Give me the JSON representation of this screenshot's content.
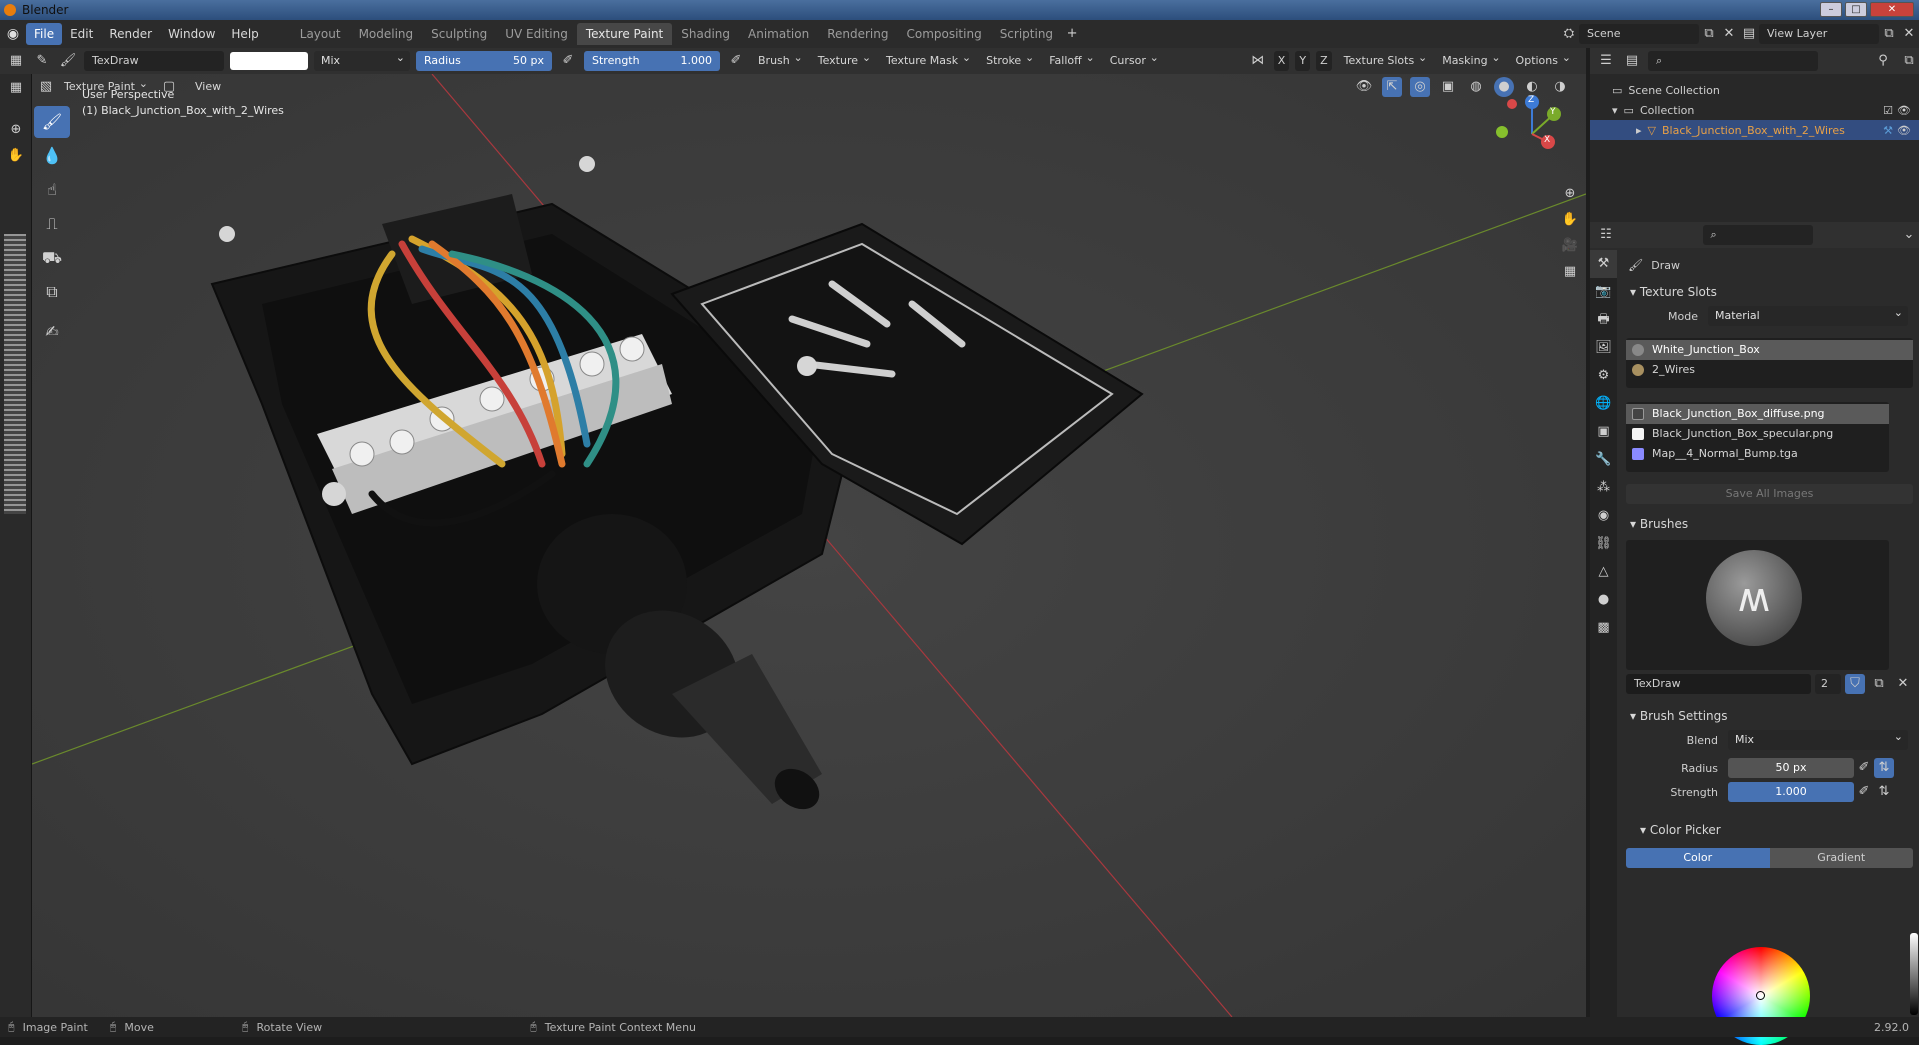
{
  "window": {
    "title": "Blender"
  },
  "menubar": {
    "menus": [
      "File",
      "Edit",
      "Render",
      "Window",
      "Help"
    ],
    "workspaces": [
      "Layout",
      "Modeling",
      "Sculpting",
      "UV Editing",
      "Texture Paint",
      "Shading",
      "Animation",
      "Rendering",
      "Compositing",
      "Scripting"
    ],
    "active_workspace": "Texture Paint",
    "scene": "Scene",
    "view_layer": "View Layer"
  },
  "header": {
    "brush_name": "TexDraw",
    "blend": "Mix",
    "radius_label": "Radius",
    "radius_value": "50 px",
    "strength_label": "Strength",
    "strength_value": "1.000",
    "menus": [
      "Brush",
      "Texture",
      "Texture Mask",
      "Stroke",
      "Falloff",
      "Cursor"
    ],
    "axes": [
      "X",
      "Y",
      "Z"
    ],
    "right_menus": [
      "Texture Slots",
      "Masking",
      "Options"
    ]
  },
  "header2": {
    "mode": "Texture Paint",
    "view": "View"
  },
  "viewport": {
    "perspective": "User Perspective",
    "object_label": "(1) Black_Junction_Box_with_2_Wires",
    "gizmo": [
      "X",
      "Y",
      "Z"
    ]
  },
  "outliner": {
    "scene_collection": "Scene Collection",
    "collection": "Collection",
    "object": "Black_Junction_Box_with_2_Wires"
  },
  "properties": {
    "tool_name": "Draw",
    "texture_slots": {
      "title": "Texture Slots",
      "mode_label": "Mode",
      "mode_value": "Material",
      "materials": [
        "White_Junction_Box",
        "2_Wires"
      ],
      "images": [
        "Black_Junction_Box_diffuse.png",
        "Black_Junction_Box_specular.png",
        "Map__4_Normal_Bump.tga"
      ],
      "save_all": "Save All Images"
    },
    "brushes": {
      "title": "Brushes",
      "brush_name": "TexDraw",
      "users": "2"
    },
    "brush_settings": {
      "title": "Brush Settings",
      "blend_label": "Blend",
      "blend_value": "Mix",
      "radius_label": "Radius",
      "radius_value": "50 px",
      "strength_label": "Strength",
      "strength_value": "1.000"
    },
    "color_picker": {
      "title": "Color Picker",
      "tabs": [
        "Color",
        "Gradient"
      ]
    }
  },
  "statusbar": {
    "items": [
      "Image Paint",
      "Move",
      "Rotate View",
      "Texture Paint Context Menu"
    ],
    "version": "2.92.0"
  },
  "colors": {
    "accent": "#4772b3",
    "selected_object": "#e8a046"
  }
}
